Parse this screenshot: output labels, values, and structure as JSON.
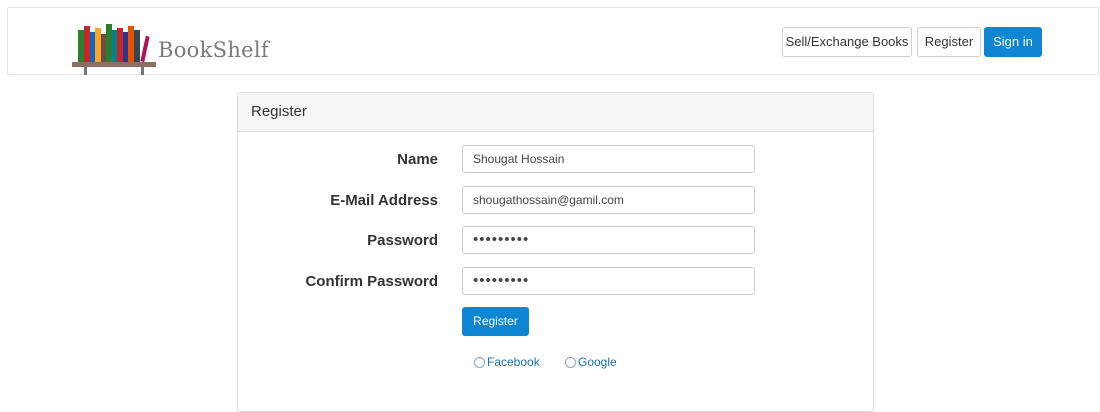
{
  "brand": {
    "name": "BookShelf"
  },
  "nav": {
    "sell_label": "Sell/Exchange Books",
    "register_label": "Register",
    "signin_label": "Sign in"
  },
  "panel": {
    "title": "Register"
  },
  "form": {
    "name": {
      "label": "Name",
      "value": "Shougat Hossain"
    },
    "email": {
      "label": "E-Mail Address",
      "value": "shougathossain@gamil.com"
    },
    "password": {
      "label": "Password",
      "value": "•••••••••"
    },
    "confirm": {
      "label": "Confirm Password",
      "value": "•••••••••"
    },
    "submit_label": "Register"
  },
  "social": {
    "facebook": "Facebook",
    "google": "Google"
  },
  "colors": {
    "primary": "#0e86d4",
    "link": "#1a6fb0"
  }
}
